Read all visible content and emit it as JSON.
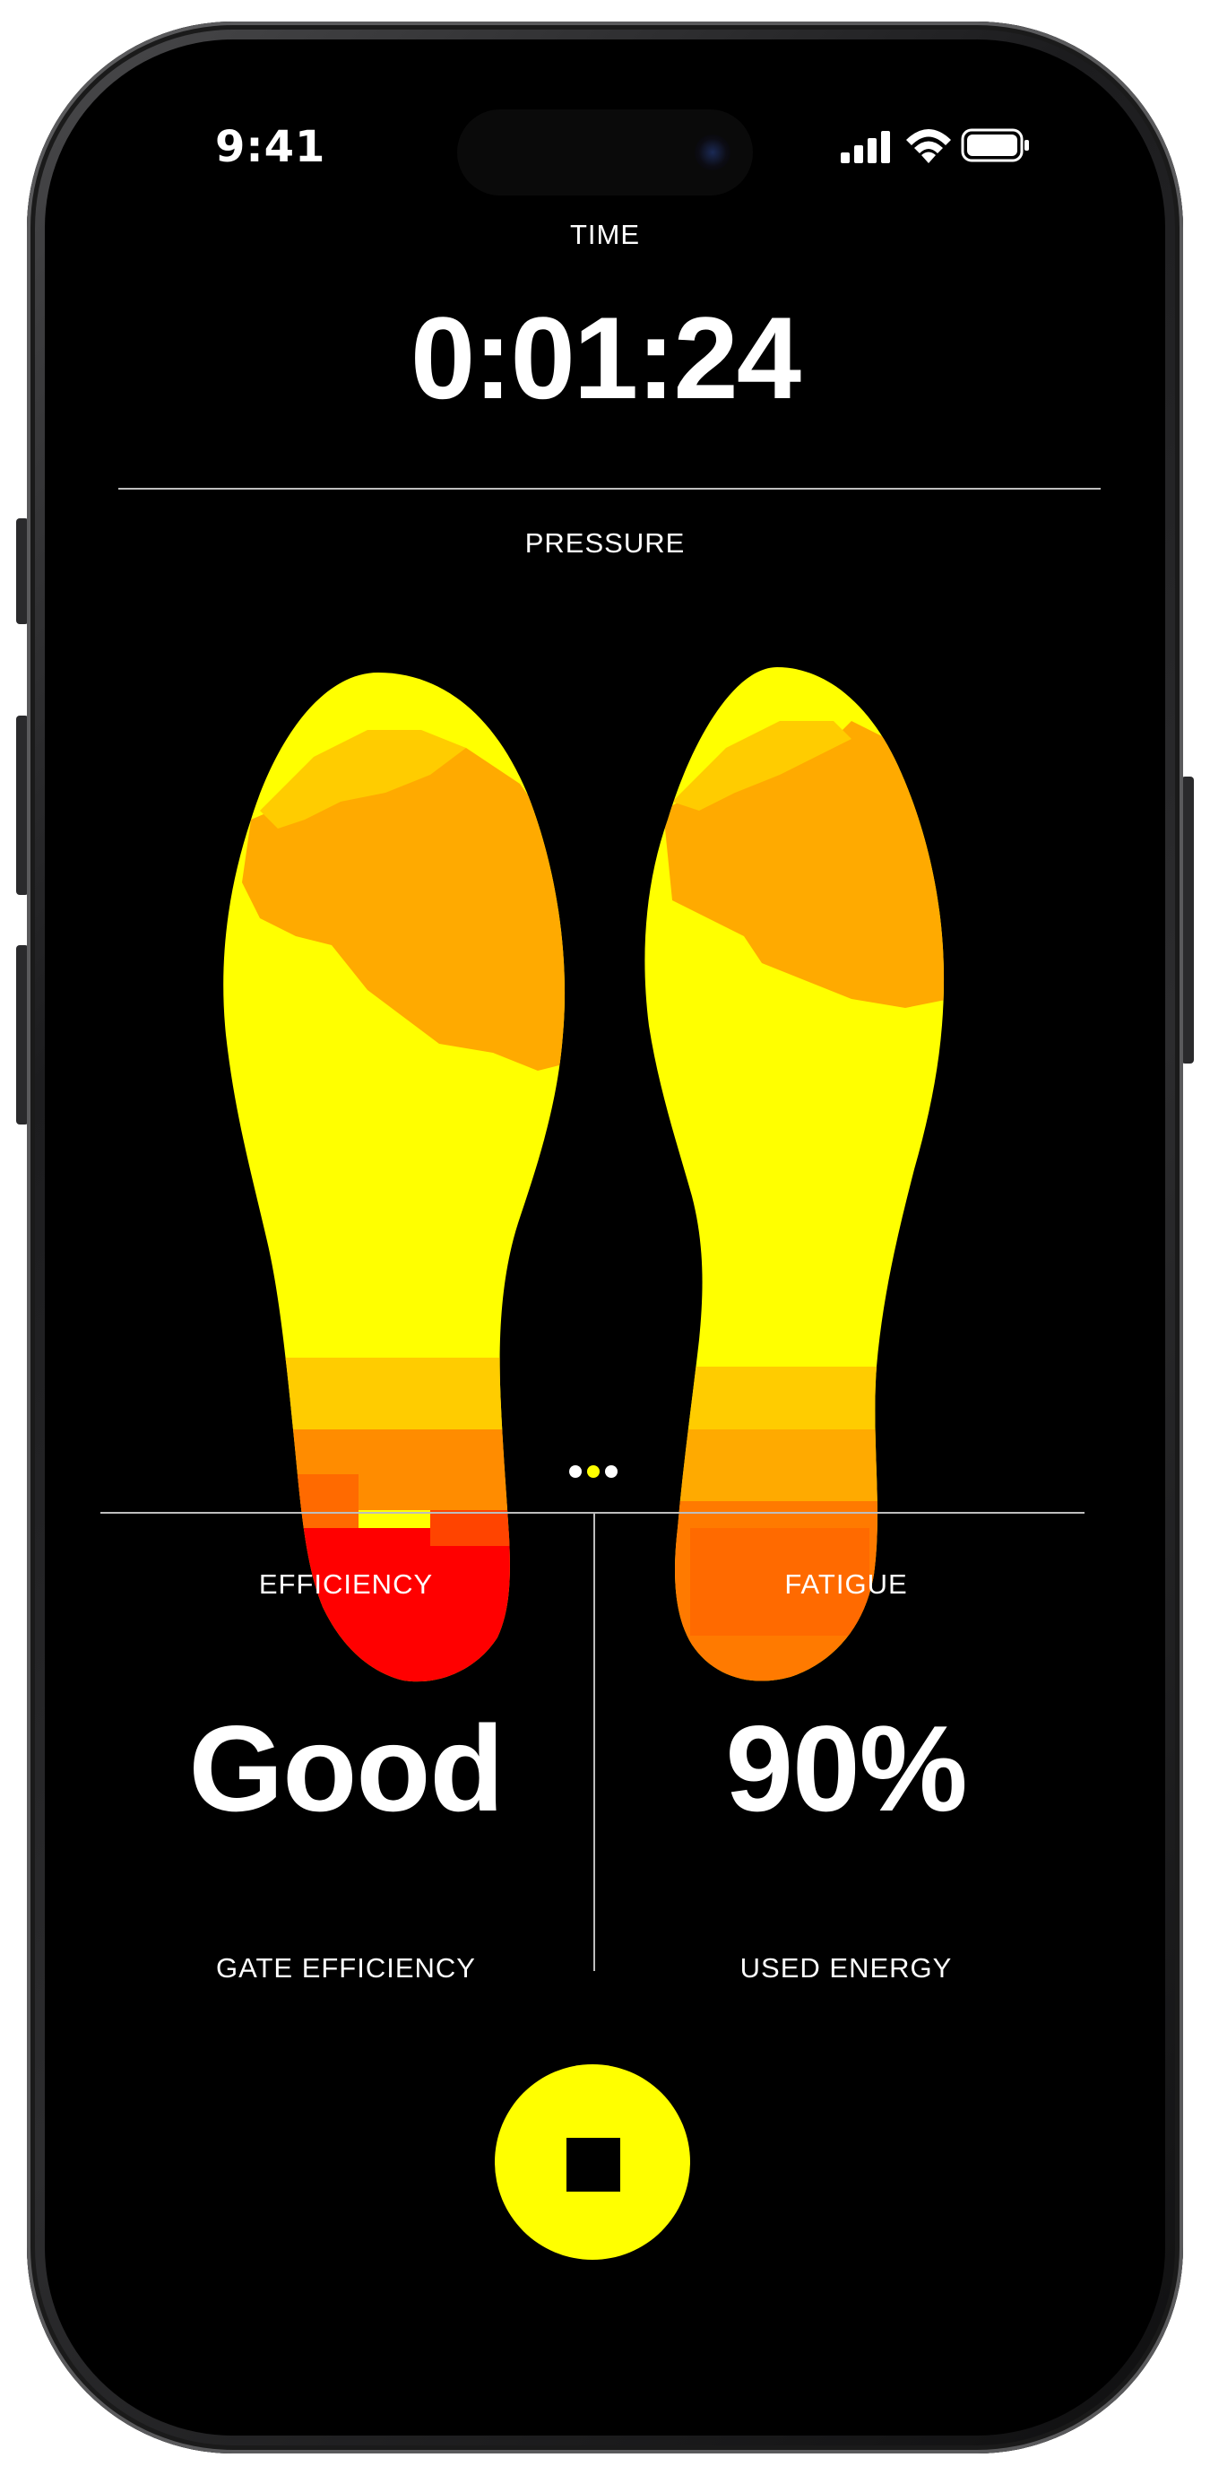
{
  "status_bar": {
    "time": "9:41",
    "icons": [
      "signal-icon",
      "wifi-icon",
      "battery-icon"
    ]
  },
  "session": {
    "time_label": "TIME",
    "time_value": "0:01:24"
  },
  "pressure": {
    "label": "PRESSURE",
    "colors": {
      "low": "#ffff00",
      "mid_low": "#ffcc00",
      "mid": "#ffaa00",
      "high": "#ff7a00",
      "very_high": "#ff4400",
      "max": "#ff0000"
    },
    "left_foot": {
      "zones": [
        {
          "region": "toes",
          "level": "low"
        },
        {
          "region": "forefoot",
          "level": "mid"
        },
        {
          "region": "midfoot",
          "level": "low"
        },
        {
          "region": "heel-upper",
          "level": "high"
        },
        {
          "region": "heel",
          "level": "max"
        }
      ]
    },
    "right_foot": {
      "zones": [
        {
          "region": "toes",
          "level": "low"
        },
        {
          "region": "forefoot",
          "level": "mid"
        },
        {
          "region": "midfoot",
          "level": "low"
        },
        {
          "region": "heel-upper",
          "level": "mid"
        },
        {
          "region": "heel",
          "level": "very_high"
        }
      ]
    }
  },
  "pager": {
    "count": 3,
    "active_index": 1,
    "active_color": "#ffff00",
    "inactive_color": "#ffffff"
  },
  "metrics": {
    "efficiency": {
      "title": "EFFICIENCY",
      "value": "Good",
      "subtitle": "GATE EFFICIENCY"
    },
    "fatigue": {
      "title": "FATIGUE",
      "value": "90%",
      "subtitle": "USED ENERGY"
    }
  },
  "controls": {
    "stop_button_color": "#ffff00",
    "stop_icon": "stop-icon"
  }
}
